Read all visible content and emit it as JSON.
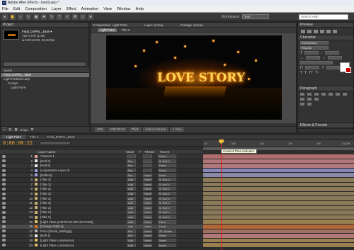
{
  "app": {
    "title": "Adobe After Effects - love9.aep *"
  },
  "menu": [
    "File",
    "Edit",
    "Composition",
    "Layer",
    "Effect",
    "Animation",
    "View",
    "Window",
    "Help"
  ],
  "workspace": {
    "label": "Workspace:",
    "value": "Text"
  },
  "search_help": {
    "placeholder": "Search Help"
  },
  "project": {
    "panel_title": "Project",
    "comp_name": "Final_DVPAL_16x9 ▾",
    "info_lines": [
      "720 x 576 (1,46)",
      "Δ 0:00:10:00, 25,00 fps"
    ],
    "list_header": "Name",
    "items": [
      "Final_DVPAL_16x9",
      "Light Particles.aep",
      "Comps",
      "Light Flare"
    ],
    "footer_bpc": "8 bpc"
  },
  "composition": {
    "panel_title": "Composition: Light Flare",
    "tabs": [
      "Layer: (none)",
      "Footage: (none)"
    ],
    "subtabs": [
      "Light Flare",
      "Title 2"
    ],
    "frame_text": "LOVE STORY",
    "controls": [
      "50%",
      "0:00:00:22",
      "Third",
      "Active Camera",
      "1 View"
    ]
  },
  "right_panels": {
    "preview": "Preview",
    "character": "Character",
    "font": "DaxlineBold",
    "style": "Regular",
    "paragraph": "Paragraph",
    "effects": "Effects & Presets"
  },
  "timeline": {
    "tabs": [
      "Light Flare",
      "Title 2",
      "Final_DVPAL_16x9"
    ],
    "timecode": "0:00:00:22",
    "columns": [
      "Layer Name",
      "Mode",
      "T",
      "TrkMat",
      "Parent"
    ],
    "ruler_ticks": [
      "0f",
      "05f",
      "10f",
      "15f",
      "20f",
      "01:00f"
    ],
    "tooltip": "Current Time Indicator",
    "layers": [
      {
        "num": "1",
        "name": "Camera 1",
        "mode": "",
        "trk": "",
        "parent": "None",
        "color": "#e8a0a0",
        "bar": "#b07070"
      },
      {
        "num": "2",
        "name": "[Null 6]",
        "mode": "Nor",
        "trk": "",
        "parent": "9. Null 4",
        "color": "#e8e8e8",
        "bar": "#b07878"
      },
      {
        "num": "3",
        "name": "[Null 6]",
        "mode": "Nor",
        "trk": "",
        "parent": "None",
        "color": "#e8e8e8",
        "bar": "#b07878"
      },
      {
        "num": "4",
        "name": "[Adjustment Layer 2]",
        "mode": "Nor",
        "trk": "",
        "parent": "None",
        "color": "#a0a0e0",
        "bar": "#8888b8"
      },
      {
        "num": "5",
        "name": "[Reflect]",
        "mode": "Nor",
        "trk": "None",
        "parent": "None",
        "color": "#a0a0e0",
        "bar": "#8a8aa8"
      },
      {
        "num": "6",
        "name": "[Title 2]",
        "mode": "Add",
        "trk": "None",
        "parent": "5. Null 4",
        "color": "#c8b070",
        "bar": "#8a7a5a"
      },
      {
        "num": "7",
        "name": "[Title 2]",
        "mode": "Add",
        "trk": "None",
        "parent": "5. Null 4",
        "color": "#c8b070",
        "bar": "#8a7a5a"
      },
      {
        "num": "8",
        "name": "[Title 2]",
        "mode": "Add",
        "trk": "None",
        "parent": "5. Null 4",
        "color": "#c8b070",
        "bar": "#8a7a5a"
      },
      {
        "num": "9",
        "name": "[Title 2]",
        "mode": "Add",
        "trk": "None",
        "parent": "5. Null 4",
        "color": "#c8b070",
        "bar": "#8a7a5a"
      },
      {
        "num": "10",
        "name": "[Title 2]",
        "mode": "Add",
        "trk": "None",
        "parent": "5. Null 4",
        "color": "#c8b070",
        "bar": "#8a7a5a"
      },
      {
        "num": "11",
        "name": "[Title 2]",
        "mode": "Add",
        "trk": "None",
        "parent": "5. Null 4",
        "color": "#c8b070",
        "bar": "#8a7a5a"
      },
      {
        "num": "12",
        "name": "[Title 2]",
        "mode": "Add",
        "trk": "None",
        "parent": "5. Null 4",
        "color": "#c8b070",
        "bar": "#8a7a5a"
      },
      {
        "num": "13",
        "name": "[Title 2]",
        "mode": "Add",
        "trk": "None",
        "parent": "5. Null 4",
        "color": "#c8b070",
        "bar": "#8a7a5a"
      },
      {
        "num": "14",
        "name": "[Title 2]",
        "mode": "Add",
        "trk": "None",
        "parent": "5. Null 4",
        "color": "#c8b070",
        "bar": "#8a7a5a"
      },
      {
        "num": "15",
        "name": "[Light Flare pARTICLE rEFLECTION]",
        "mode": "Add",
        "trk": "None",
        "parent": "None",
        "color": "#e0c060",
        "bar": "#9a8050"
      },
      {
        "num": "16",
        "name": "[Orange Solid 4]",
        "mode": "Add",
        "trk": "None",
        "parent": "None",
        "color": "#e07020",
        "bar": "#b06838"
      },
      {
        "num": "17",
        "name": "Floor [Stone_Wall.jpg]",
        "mode": "Nor",
        "trk": "None",
        "parent": "20. Shake",
        "color": "#b0b0b0",
        "bar": "#a07060"
      },
      {
        "num": "18",
        "name": "[Null 1]",
        "mode": "Nor",
        "trk": "None",
        "parent": "None",
        "color": "#e8e8e8",
        "bar": "#b07878"
      },
      {
        "num": "19",
        "name": "[Light Flare Luminance]",
        "mode": "Add",
        "trk": "None",
        "parent": "None",
        "color": "#e0c060",
        "bar": "#9a8050"
      },
      {
        "num": "20",
        "name": "[Light Flare Luminance]",
        "mode": "Add",
        "trk": "None",
        "parent": "None",
        "color": "#e0c060",
        "bar": "#9a8050"
      }
    ]
  }
}
